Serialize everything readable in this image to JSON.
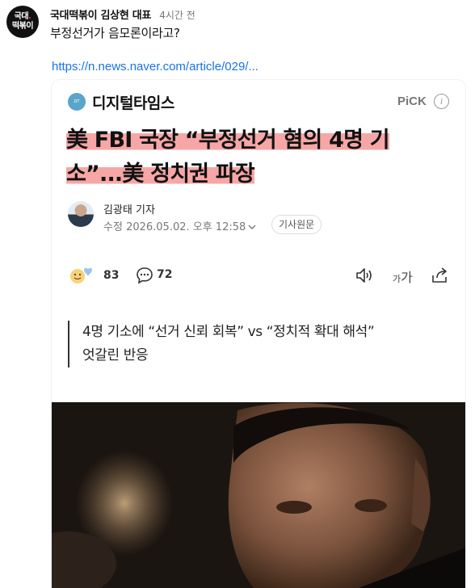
{
  "post": {
    "author": "국대떡볶이 김상현 대표",
    "time": "4시간 전",
    "avatar_text_line1": "국대",
    "avatar_text_line2": "떡볶이",
    "text": "부정선거가 음모론이라고?",
    "link": "https://n.news.naver.com/article/029/..."
  },
  "card": {
    "press_name": "디지털타임스",
    "pick_label": "PiCK",
    "headline_line1": "美 FBI 국장 “부정선거 혐의 4명 기",
    "headline_line2": "소”...美 정치권 파장",
    "reporter": "김광태 기자",
    "modified_label": "수정",
    "modified_datetime": "2026.05.02. 오후 12:58",
    "original_label": "기사원문",
    "reaction_count": "83",
    "comment_count": "72",
    "font_size_label_small": "가",
    "font_size_label_large": "가",
    "summary_line1": "4명 기소에 “선거 신뢰 회복” vs “정치적 확대 해석”",
    "summary_line2": "엇갈린 반응"
  },
  "icons": {
    "info": "info-icon",
    "reaction": "reaction-emoji-icon",
    "comment": "comment-icon",
    "audio": "audio-icon",
    "share": "share-icon"
  },
  "colors": {
    "link": "#1a73e8",
    "headline_highlight": "#f7a6a6",
    "press_logo": "#58a6c9"
  }
}
